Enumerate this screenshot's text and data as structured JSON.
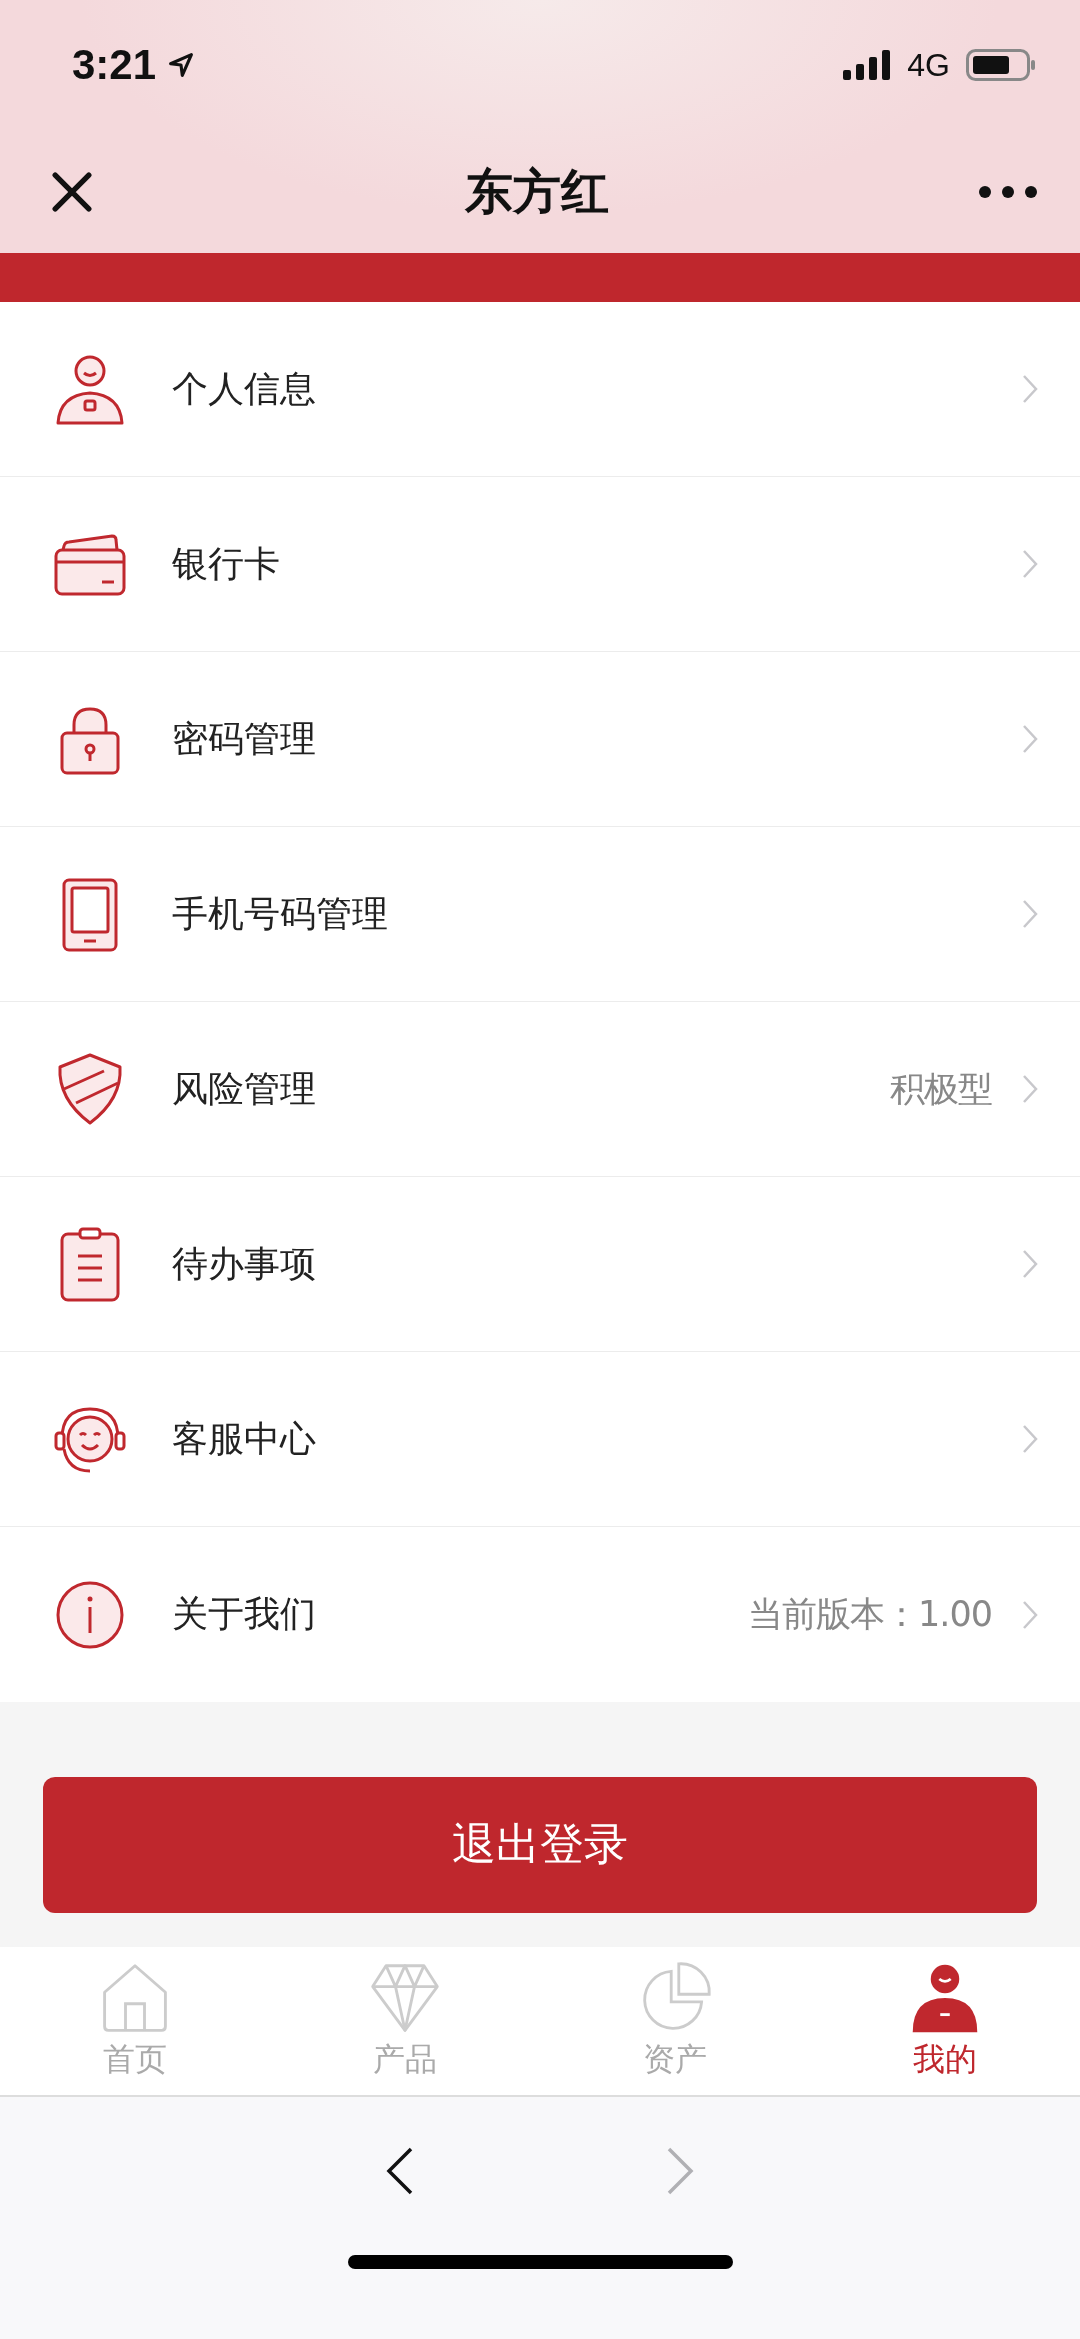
{
  "status_bar": {
    "time": "3:21",
    "network": "4G"
  },
  "nav": {
    "title": "东方红"
  },
  "menu": [
    {
      "label": "个人信息"
    },
    {
      "label": "银行卡"
    },
    {
      "label": "密码管理"
    },
    {
      "label": "手机号码管理"
    },
    {
      "label": "风险管理",
      "value": "积极型"
    },
    {
      "label": "待办事项"
    },
    {
      "label": "客服中心"
    },
    {
      "label": "关于我们",
      "value": "当前版本：1.00"
    }
  ],
  "logout_button": "退出登录",
  "tabs": [
    {
      "label": "首页",
      "selected": false
    },
    {
      "label": "产品",
      "selected": false
    },
    {
      "label": "资产",
      "selected": false
    },
    {
      "label": "我的",
      "selected": true
    }
  ],
  "browser_bar": {
    "back_enabled": true,
    "forward_enabled": false
  }
}
